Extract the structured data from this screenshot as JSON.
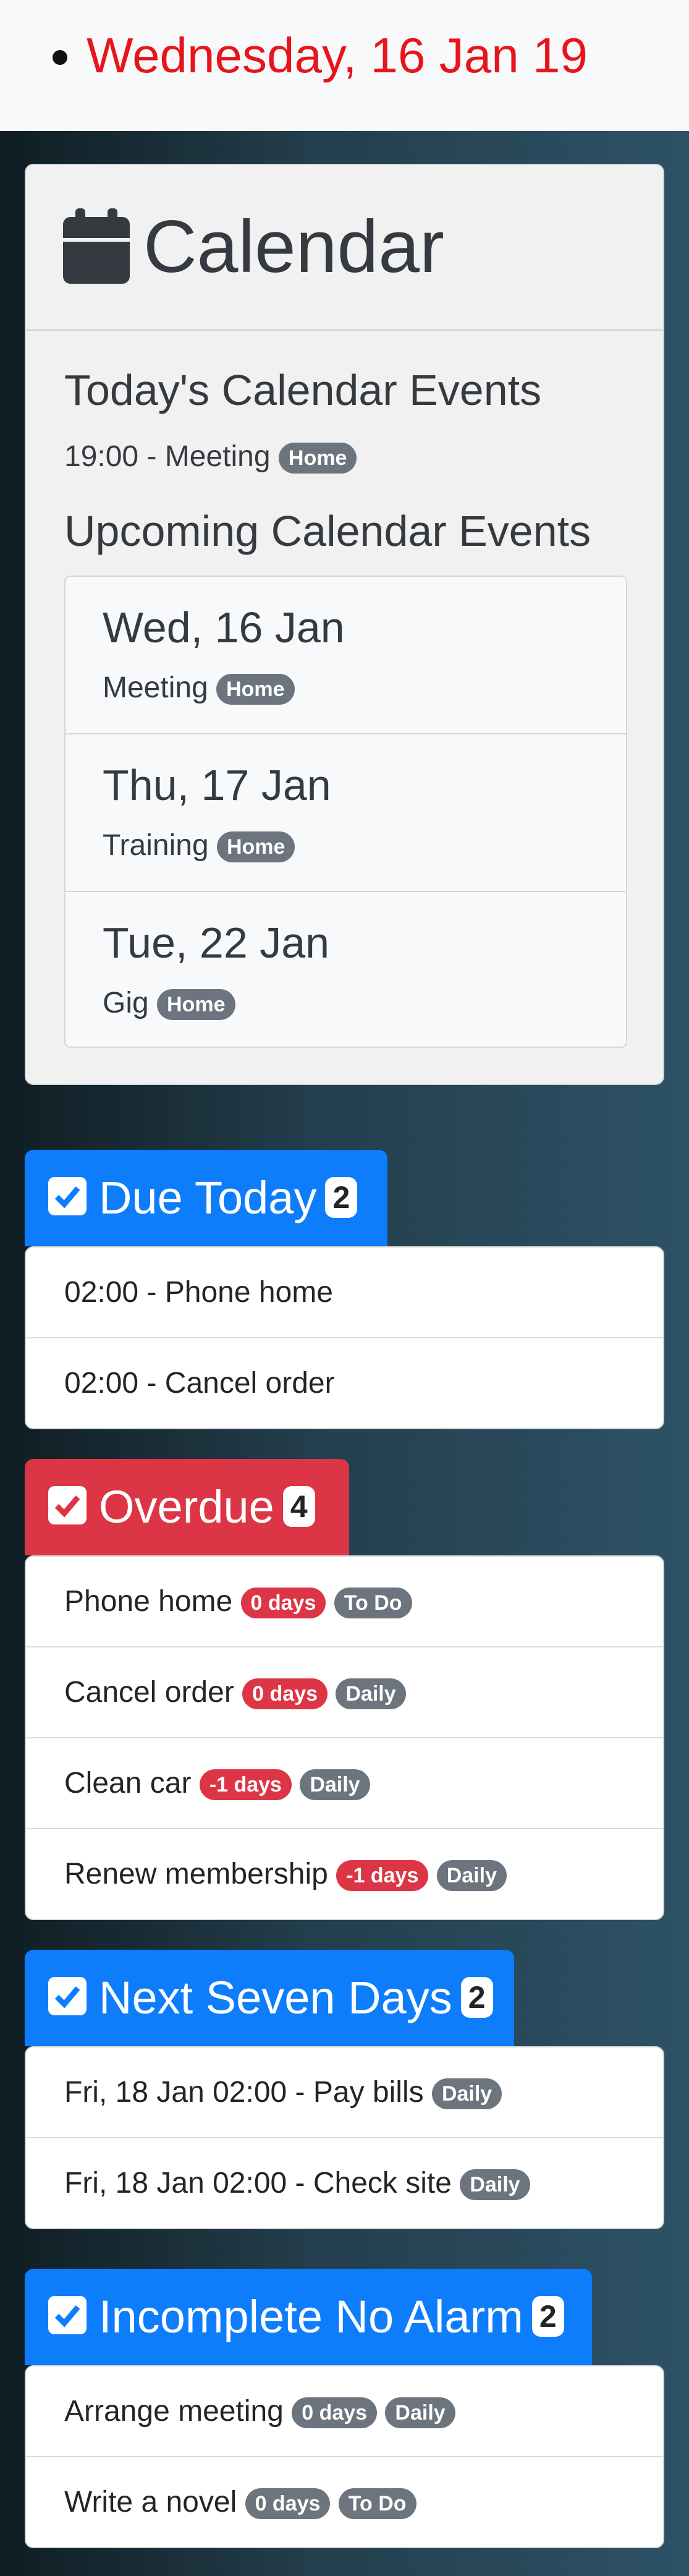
{
  "header": {
    "date": "Wednesday, 16 Jan 19"
  },
  "calendar": {
    "title": "Calendar",
    "today_title": "Today's Calendar Events",
    "today_events": [
      {
        "text": "19:00 - Meeting",
        "tag": "Home"
      }
    ],
    "upcoming_title": "Upcoming Calendar Events",
    "upcoming": [
      {
        "date": "Wed, 16 Jan",
        "name": "Meeting",
        "tag": "Home"
      },
      {
        "date": "Thu, 17 Jan",
        "name": "Training",
        "tag": "Home"
      },
      {
        "date": "Tue, 22 Jan",
        "name": "Gig",
        "tag": "Home"
      }
    ]
  },
  "due_today": {
    "title": "Due Today",
    "count": "2",
    "color": "#0d7dfb",
    "items": [
      {
        "text": "02:00 - Phone home"
      },
      {
        "text": "02:00 - Cancel order"
      }
    ]
  },
  "overdue": {
    "title": "Overdue",
    "count": "4",
    "color": "#dc3545",
    "items": [
      {
        "text": "Phone home",
        "days": "0 days",
        "tag": "To Do"
      },
      {
        "text": "Cancel order",
        "days": "0 days",
        "tag": "Daily"
      },
      {
        "text": "Clean car",
        "days": "-1 days",
        "tag": "Daily"
      },
      {
        "text": "Renew membership",
        "days": "-1 days",
        "tag": "Daily"
      }
    ]
  },
  "next_seven": {
    "title": "Next Seven Days",
    "count": "2",
    "color": "#0d7dfb",
    "items": [
      {
        "text": "Fri, 18 Jan 02:00 - Pay bills",
        "tag": "Daily"
      },
      {
        "text": "Fri, 18 Jan 02:00 - Check site",
        "tag": "Daily"
      }
    ]
  },
  "incomplete": {
    "title": "Incomplete No Alarm",
    "count": "2",
    "color": "#0d7dfb",
    "items": [
      {
        "text": "Arrange meeting",
        "days": "0 days",
        "tag": "Daily"
      },
      {
        "text": "Write a novel",
        "days": "0 days",
        "tag": "To Do"
      }
    ]
  },
  "icons": {
    "calendar": "calendar-icon",
    "check": "check-square-icon"
  }
}
